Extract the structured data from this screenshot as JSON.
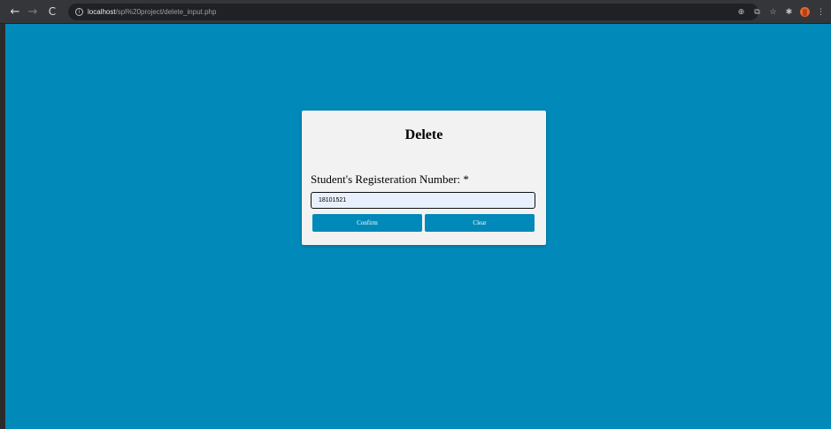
{
  "browser": {
    "back_icon": "←",
    "forward_icon": "→",
    "reload_icon": "C",
    "info_icon": "i",
    "url_host": "localhost",
    "url_path": "/spl%20project/delete_input.php",
    "zoom_icon": "⊕",
    "share_icon": "⧉",
    "bookmark_icon": "☆",
    "extensions_icon": "✱",
    "menu_icon": "⋮"
  },
  "form": {
    "title": "Delete",
    "label": "Student's Registeration Number: *",
    "reg_value": "18101521",
    "confirm_label": "Confirm",
    "clear_label": "Clear"
  },
  "colors": {
    "page_background": "#0189b9",
    "card_background": "#f2f2f2",
    "button_background": "#0189b9",
    "input_background": "#e8f0fe"
  }
}
